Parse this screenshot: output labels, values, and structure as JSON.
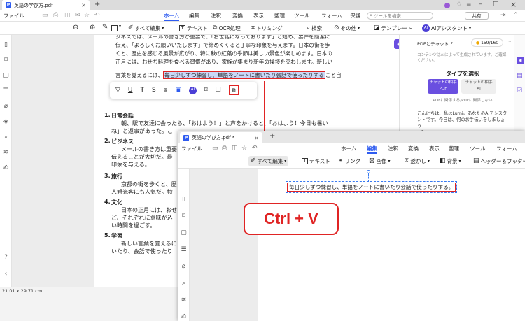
{
  "back": {
    "tab_title": "英語の学び方.pdf",
    "file_label": "ファイル",
    "menus": [
      "ホーム",
      "編集",
      "注釈",
      "変換",
      "表示",
      "整理",
      "ツール",
      "フォーム",
      "保護"
    ],
    "search_placeholder": "ツールを検索",
    "share_label": "共有",
    "toolbar": {
      "all_edit": "すべて編集",
      "text": "テキスト",
      "ocr": "OCR処理",
      "trim": "トリミング",
      "search": "検索",
      "other": "その他",
      "template": "テンプレート",
      "ai_assistant": "AIアシスタント"
    },
    "body_lines": [
      "ジネスでは、メールの書き方が重要で、「お世話になっております」と始め、要件を簡潔に",
      "伝え、「よろしくお願いいたします」で締めくくると丁寧な印象を与えます。日本の街を歩",
      "くと、歴史を感じる風景が広がり、特に秋の紅葉の季節は美しい景色が楽しめます。日本の",
      "正月には、おせち料理を食べる習慣があり、家族が集まり新年の挨拶を交わします。新しい"
    ],
    "line5_prefix": "言葉を覚えるには、",
    "line5_selected": "毎日少しずつ練習し、単語をノートに書いたり会話で使ったりする",
    "line5_suffix": "こと自",
    "list": [
      {
        "num": "1.",
        "title": "日常会話",
        "lines": [
          "朝、駅で友達に会ったら、「おはよう！」と声をかけると、「おはよう！今日も暑い",
          "ね」と返事があった。こ"
        ]
      },
      {
        "num": "2.",
        "title": "ビジネス",
        "lines": [
          "メールの書き方は重要",
          "伝えることが大切だ。最",
          "印象を与える。"
        ]
      },
      {
        "num": "3.",
        "title": "旅行",
        "lines": [
          "京都の街を歩くと、歴",
          "人観光客にも人気だ。特"
        ]
      },
      {
        "num": "4.",
        "title": "文化",
        "lines": [
          "日本の正月には、おせ",
          "ど、それぞれに意味が込",
          "い時間を過ごす。"
        ]
      },
      {
        "num": "5.",
        "title": "学習",
        "lines": [
          "新しい言葉を覚えるに",
          "いたり、会話で使ったり"
        ]
      }
    ],
    "status_size": "21.01 x 29.71 cm",
    "panel": {
      "dropdown": "PDFとチャット",
      "credits": "159/160",
      "notice": "コンテンツはAIによって生成されています。ご確認ください。",
      "type_title": "タイプを選択",
      "opt_pdf_line1": "チャットの相手",
      "opt_pdf_line2": "PDF",
      "opt_ai_line1": "チャットの相手",
      "opt_ai_line2": "AI",
      "opt_caption": "PDFに関係する/PDFに関係しない",
      "greeting": [
        "こんにちは、私はLumi。あなたのAIアシスタ",
        "ントです。今日は、何のお手伝いをしましょう",
        "か？"
      ]
    }
  },
  "front": {
    "tab_title": "英語の学び方.pdf *",
    "file_label": "ファイル",
    "menus": [
      "ホーム",
      "編集",
      "注釈",
      "変換",
      "表示",
      "整理",
      "ツール",
      "フォーム"
    ],
    "toolbar": {
      "all_edit": "すべて編集",
      "text": "テキスト",
      "link": "リンク",
      "image": "画像",
      "watermark": "透かし",
      "background": "背景",
      "header_footer": "ヘッダー＆フッター"
    },
    "pasted_text": "毎日少しずつ練習し、単語をノートに書いたり会話で使ったりする。"
  },
  "callout": "Ctrl + V",
  "colors": {
    "accent": "#2f5cf0",
    "callout": "#e02424"
  }
}
